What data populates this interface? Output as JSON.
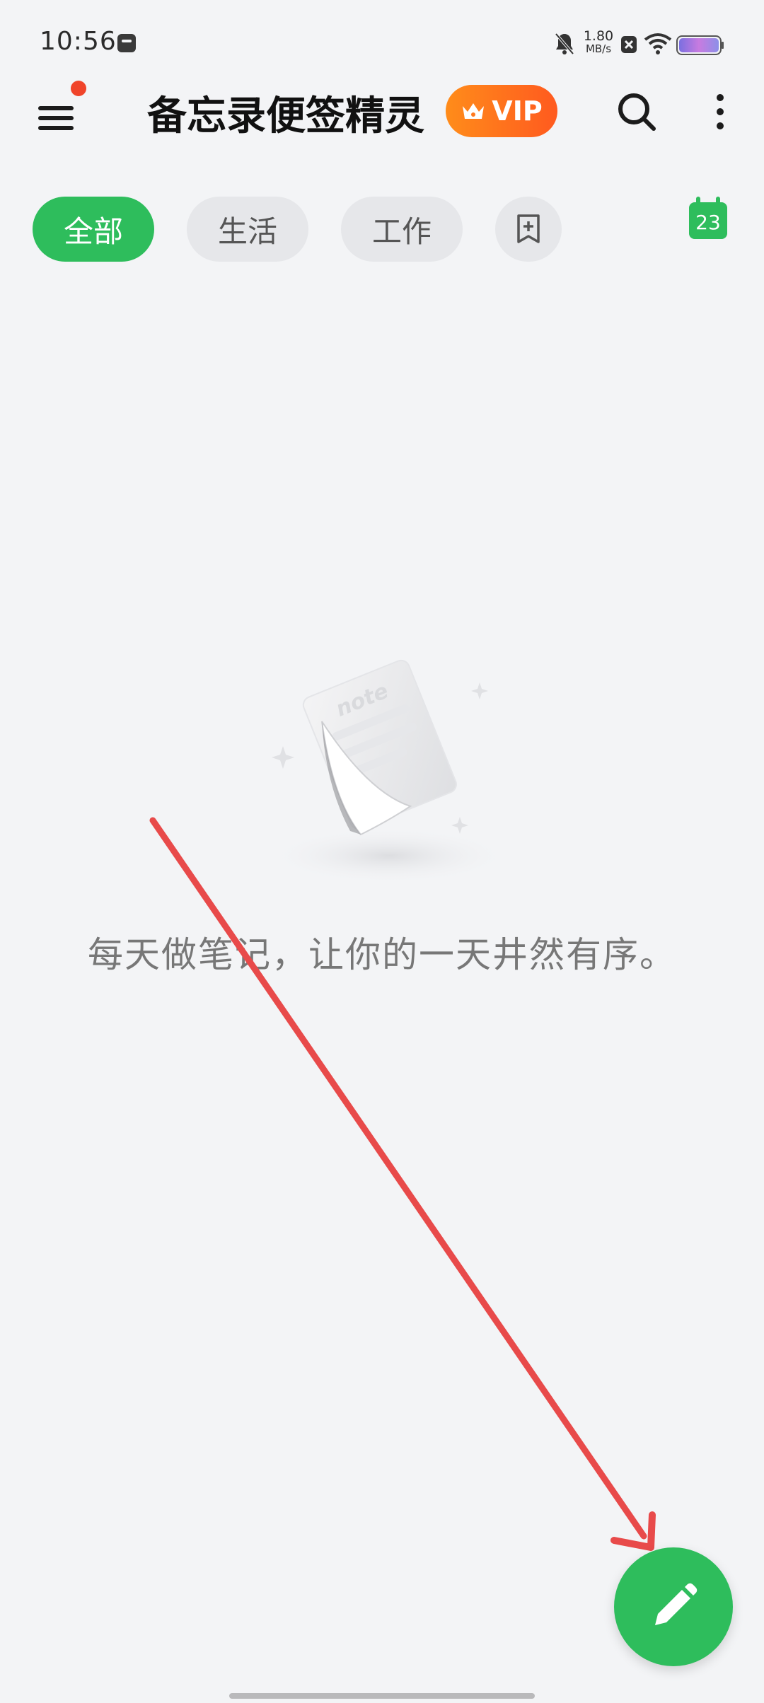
{
  "status_bar": {
    "time": "10:56",
    "net_speed_value": "1.80",
    "net_speed_unit": "MB/s",
    "icons": [
      "notification-icon",
      "bell-off-icon",
      "x-badge-icon",
      "wifi-icon",
      "battery-icon"
    ]
  },
  "header": {
    "title": "备忘录便签精灵",
    "vip_label": "VIP",
    "icons": [
      "menu-icon",
      "crown-icon",
      "search-icon",
      "more-vert-icon"
    ],
    "accent_color": "#ff6a1f",
    "menu_dot_color": "#f0442a"
  },
  "tabs": [
    {
      "label": "全部",
      "active": true
    },
    {
      "label": "生活",
      "active": false
    },
    {
      "label": "工作",
      "active": false
    }
  ],
  "tab_add_icon": "bookmark-add-icon",
  "calendar": {
    "day": "23"
  },
  "empty_state": {
    "illustration_text": "note",
    "message": "每天做笔记，让你的一天井然有序。"
  },
  "fab_icon": "pencil-icon",
  "colors": {
    "brand_green": "#2ebd5c",
    "background": "#f3f4f6",
    "annotation_red": "#e84a4a"
  }
}
